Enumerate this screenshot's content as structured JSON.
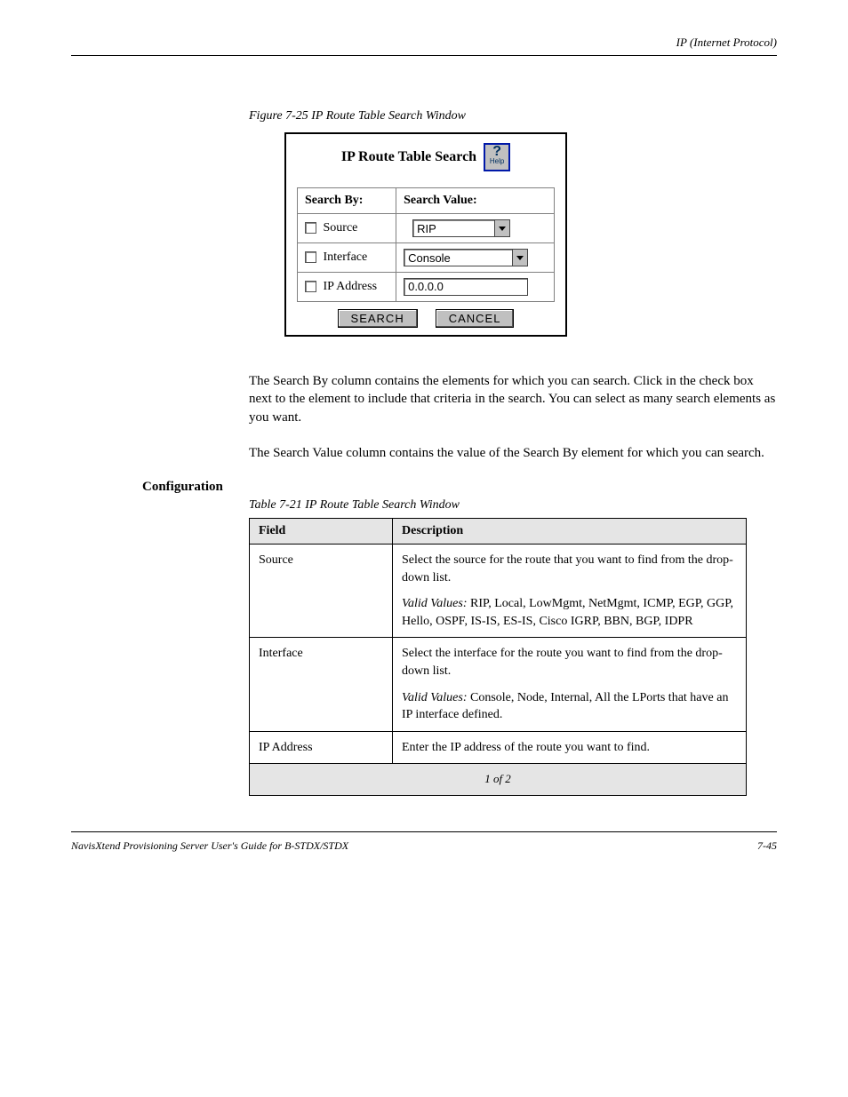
{
  "header": {
    "right": "IP (Internet Protocol)"
  },
  "figure": {
    "caption": "Figure 7-25    IP Route Table Search Window"
  },
  "dialog": {
    "title": "IP Route Table Search",
    "help_label": "Help",
    "columns": {
      "by": "Search By:",
      "value": "Search Value:"
    },
    "rows": {
      "source": {
        "label": "Source",
        "value": "RIP"
      },
      "interface": {
        "label": "Interface",
        "value": "Console"
      },
      "ip": {
        "label": "IP Address",
        "value": "0.0.0.0"
      }
    },
    "buttons": {
      "search": "SEARCH",
      "cancel": "CANCEL"
    }
  },
  "body": {
    "p1": "The Search By column contains the elements for which you can search. Click in the check box next to the element to include that criteria in the search. You can select as many search elements as you want.",
    "p2": "The Search Value column contains the value of the Search By element for which you can search.",
    "section_label": "Configuration"
  },
  "ref_table": {
    "title": "Table 7-21 IP Route Table Search Window",
    "headers": {
      "field": "Field",
      "desc": "Description"
    },
    "rows": [
      {
        "field": "Source",
        "desc": "Select the source for the route that you want to find from the drop-down list.",
        "desc2_label": "Valid Values:",
        "desc2": "RIP, Local, LowMgmt, NetMgmt, ICMP, EGP, GGP, Hello, OSPF, IS-IS, ES-IS, Cisco IGRP, BBN, BGP, IDPR"
      },
      {
        "field": "Interface",
        "desc": "Select the interface for the route you want to find from the drop-down list.",
        "desc2_label": "Valid Values:",
        "desc2": "Console, Node, Internal, All the LPorts that have an IP interface defined."
      },
      {
        "field": "IP Address",
        "desc": "Enter the IP address of the route you want to find."
      }
    ],
    "continued": "1 of 2"
  },
  "footer": {
    "left": "NavisXtend Provisioning Server User's Guide for B-STDX/STDX",
    "right": "7-45"
  }
}
